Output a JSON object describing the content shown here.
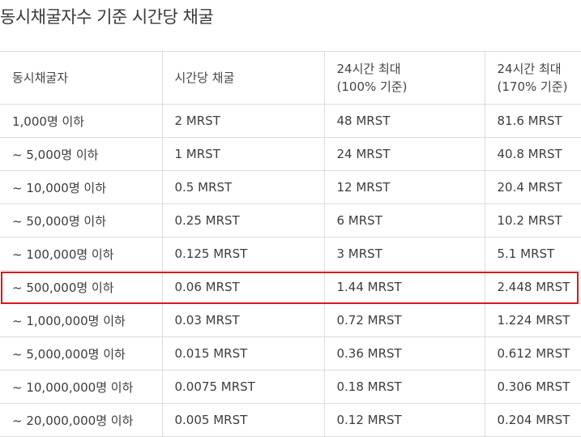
{
  "title": "동시채굴자수 기준 시간당 채굴",
  "table": {
    "headers": [
      {
        "line1": "동시채굴자",
        "line2": ""
      },
      {
        "line1": "시간당 채굴",
        "line2": ""
      },
      {
        "line1": "24시간 최대",
        "line2": "(100% 기준)"
      },
      {
        "line1": "24시간 최대",
        "line2": "(170% 기준)"
      }
    ],
    "rows": [
      [
        "1,000명 이하",
        "2 MRST",
        "48 MRST",
        "81.6 MRST"
      ],
      [
        "~ 5,000명 이하",
        "1 MRST",
        "24 MRST",
        "40.8 MRST"
      ],
      [
        "~ 10,000명 이하",
        "0.5 MRST",
        "12 MRST",
        "20.4 MRST"
      ],
      [
        "~ 50,000명 이하",
        "0.25 MRST",
        "6 MRST",
        "10.2 MRST"
      ],
      [
        "~ 100,000명 이하",
        "0.125 MRST",
        "3 MRST",
        "5.1 MRST"
      ],
      [
        "~ 500,000명 이하",
        "0.06 MRST",
        "1.44 MRST",
        "2.448 MRST"
      ],
      [
        "~ 1,000,000명 이하",
        "0.03 MRST",
        "0.72 MRST",
        "1.224 MRST"
      ],
      [
        "~ 5,000,000명 이하",
        "0.015 MRST",
        "0.36 MRST",
        "0.612 MRST"
      ],
      [
        "~ 10,000,000명 이하",
        "0.0075 MRST",
        "0.18 MRST",
        "0.306 MRST"
      ],
      [
        "~ 20,000,000명 이하",
        "0.005 MRST",
        "0.12 MRST",
        "0.204 MRST"
      ]
    ],
    "highlighted_row": 5,
    "highlight_color": "#e0161b"
  }
}
